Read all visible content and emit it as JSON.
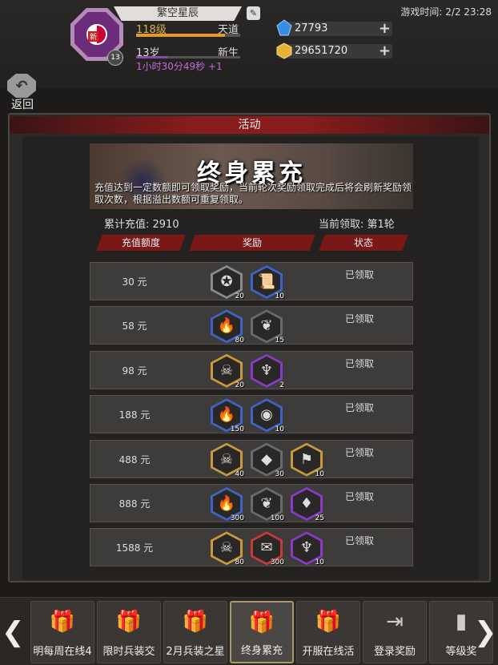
{
  "header": {
    "player_name": "繁空星辰",
    "level": "118级",
    "rank": "天道",
    "level_progress": 0.85,
    "age": "13岁",
    "stage": "新生",
    "stage_progress": 0.3,
    "timer": "1小时30分49秒 +1",
    "avatar_tag": "新",
    "avatar_level": "13",
    "game_time": "游戏时间: 2/2 23:28",
    "currency": [
      {
        "icon": "blue-gem-icon",
        "amount": "27793"
      },
      {
        "icon": "gold-ingot-icon",
        "amount": "29651720"
      }
    ],
    "back_label": "返回"
  },
  "panel": {
    "title": "活动",
    "banner_title": "终身累充",
    "banner_desc": "充值达到一定数额即可领取奖励，当前轮次奖励领取完成后将会刷新奖励领取次数，根据溢出数额可重复领取。",
    "total_recharge": "累计充值: 2910",
    "current_round": "当前领取: 第1轮",
    "columns": [
      "充值额度",
      "奖励",
      "状态"
    ]
  },
  "rows": [
    {
      "amount": "30 元",
      "status": "已领取",
      "rewards": [
        {
          "icon": "silver-coin-icon",
          "count": "20",
          "frame": "#8a8a8a"
        },
        {
          "icon": "scroll-icon",
          "count": "10",
          "frame": "#3f63c8"
        }
      ]
    },
    {
      "amount": "58 元",
      "status": "已领取",
      "rewards": [
        {
          "icon": "torch-icon",
          "count": "80",
          "frame": "#3f63c8"
        },
        {
          "icon": "feather-icon",
          "count": "15",
          "frame": "#6a6a6a"
        }
      ]
    },
    {
      "amount": "98 元",
      "status": "已领取",
      "rewards": [
        {
          "icon": "skull-icon",
          "count": "20",
          "frame": "#c89a3a"
        },
        {
          "icon": "goblet-icon",
          "count": "2",
          "frame": "#8a3ac8"
        }
      ]
    },
    {
      "amount": "188 元",
      "status": "已领取",
      "rewards": [
        {
          "icon": "torch-icon",
          "count": "150",
          "frame": "#3f63c8"
        },
        {
          "icon": "compass-icon",
          "count": "10",
          "frame": "#3f63c8"
        }
      ]
    },
    {
      "amount": "488 元",
      "status": "已领取",
      "rewards": [
        {
          "icon": "skull-icon",
          "count": "40",
          "frame": "#c89a3a"
        },
        {
          "icon": "crystal-icon",
          "count": "30",
          "frame": "#6a6a6a"
        },
        {
          "icon": "banner-icon",
          "count": "10",
          "frame": "#c89a3a"
        }
      ]
    },
    {
      "amount": "888 元",
      "status": "已领取",
      "rewards": [
        {
          "icon": "torch-icon",
          "count": "300",
          "frame": "#3f63c8"
        },
        {
          "icon": "feather-icon",
          "count": "100",
          "frame": "#6a6a6a"
        },
        {
          "icon": "crystal-shard-icon",
          "count": "25",
          "frame": "#8a3ac8"
        }
      ]
    },
    {
      "amount": "1588 元",
      "status": "已领取",
      "rewards": [
        {
          "icon": "skull-icon",
          "count": "80",
          "frame": "#c89a3a"
        },
        {
          "icon": "red-scroll-icon",
          "count": "300",
          "frame": "#c83a3a"
        },
        {
          "icon": "goblet-icon",
          "count": "10",
          "frame": "#8a3ac8"
        }
      ]
    }
  ],
  "tabs": [
    {
      "icon": "gift-icon",
      "label": "明每周在线4"
    },
    {
      "icon": "gift-icon",
      "label": "限时兵装交"
    },
    {
      "icon": "gift-icon",
      "label": "2月兵装之星"
    },
    {
      "icon": "gift-icon",
      "label": "终身累充",
      "active": true
    },
    {
      "icon": "gift-icon",
      "label": "开服在线活"
    },
    {
      "icon": "login-icon",
      "label": "登录奖励"
    },
    {
      "icon": "level-icon",
      "label": "等级奖"
    }
  ]
}
